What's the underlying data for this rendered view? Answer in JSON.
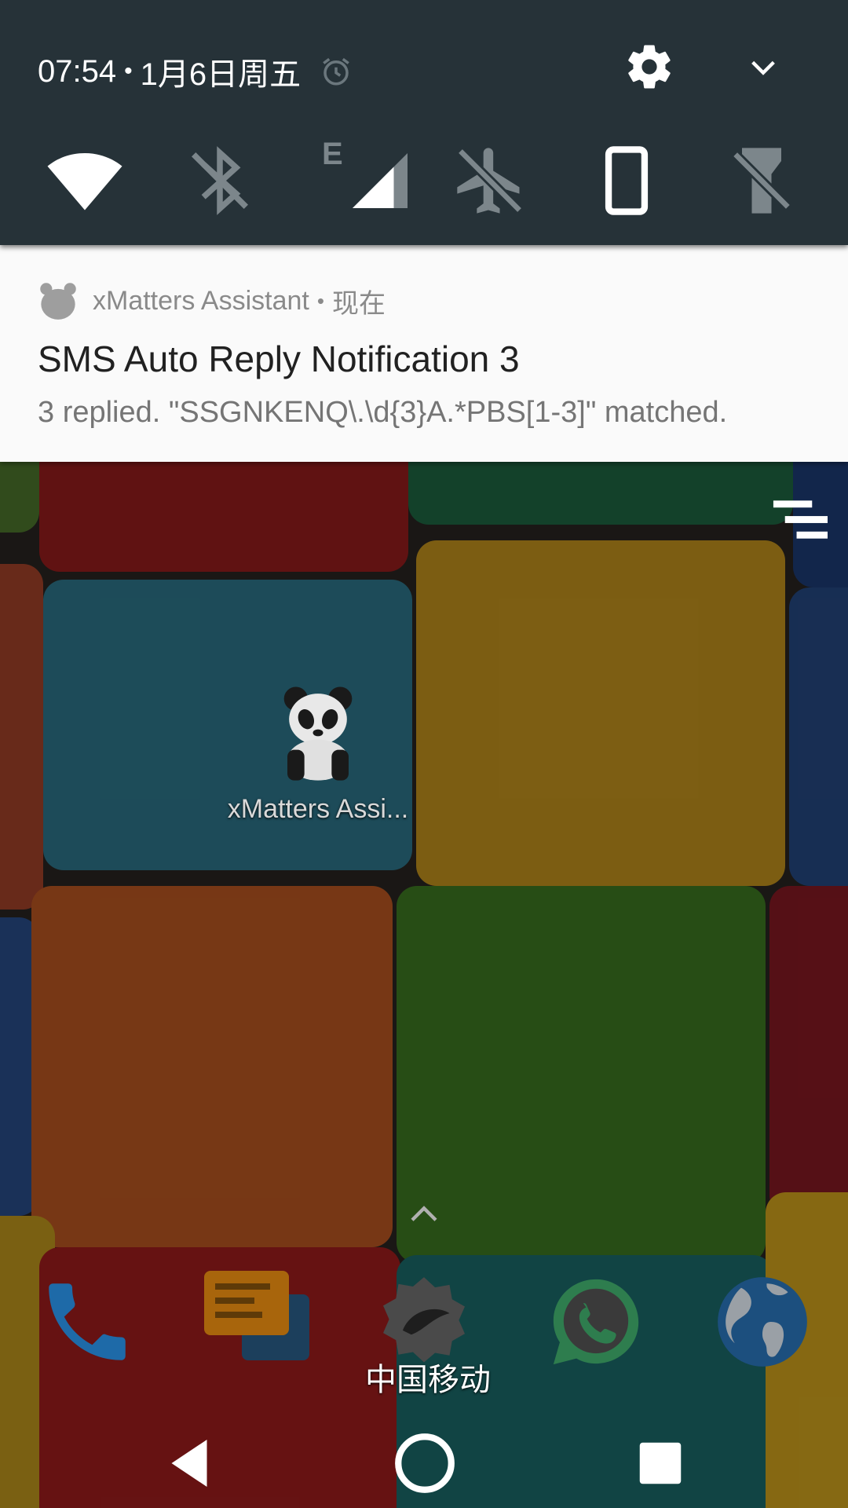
{
  "quick_settings": {
    "time": "07:54",
    "separator": "•",
    "date": "1月6日周五",
    "icons": {
      "alarm": "alarm-clock-icon",
      "settings": "gear-icon",
      "expand": "chevron-down-icon"
    },
    "tiles": [
      {
        "name": "wifi-icon",
        "active": true
      },
      {
        "name": "bluetooth-off-icon",
        "active": false
      },
      {
        "name": "cellular-signal-icon",
        "badge": "E",
        "active": true
      },
      {
        "name": "airplane-mode-icon",
        "active": false
      },
      {
        "name": "auto-rotate-icon",
        "active": true
      },
      {
        "name": "flashlight-icon",
        "active": false
      }
    ]
  },
  "notification": {
    "app_name": "xMatters Assistant",
    "separator": "•",
    "time": "现在",
    "title": "SMS Auto Reply Notification 3",
    "text": "3 replied. \"SSGNKENQ\\.\\d{3}A.*PBS[1-3]\" matched."
  },
  "home": {
    "app_label": "xMatters Assi...",
    "dock": [
      "phone-icon",
      "messages-icon",
      "camera-icon",
      "whatsapp-icon",
      "browser-icon"
    ],
    "carrier": "中国移动"
  },
  "navigation": [
    "back-icon",
    "home-icon",
    "recents-icon"
  ],
  "colors": {
    "panel": "#263238",
    "notification_bg": "#fafafa",
    "title_text": "#212121",
    "body_text": "#757575",
    "inactive_icon": "#7c868b"
  }
}
